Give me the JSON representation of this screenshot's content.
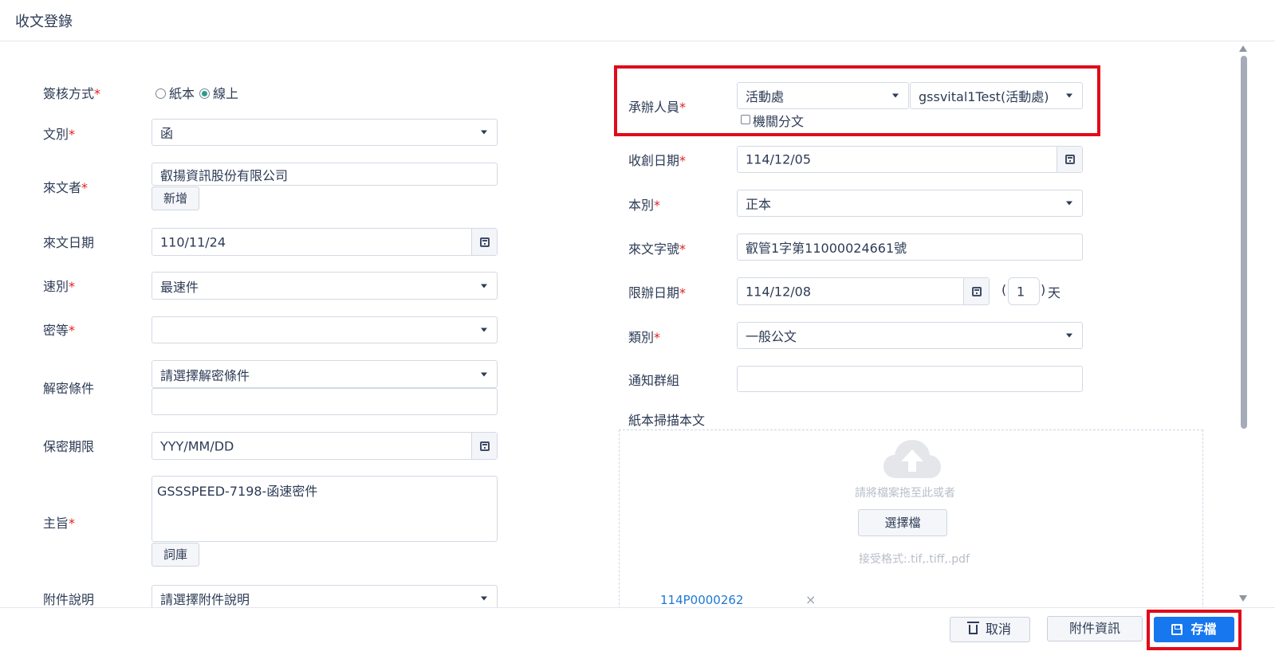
{
  "header": {
    "title": "收文登錄"
  },
  "left": {
    "sign_method": {
      "label": "簽核方式",
      "options": [
        "紙本",
        "線上"
      ],
      "selected": "線上"
    },
    "doc_type": {
      "label": "文別",
      "value": "函"
    },
    "sender": {
      "label": "來文者",
      "value": "叡揚資訊股份有限公司",
      "add_button": "新增"
    },
    "incoming_date": {
      "label": "來文日期",
      "value": "110/11/24"
    },
    "speed": {
      "label": "速別",
      "value": "最速件"
    },
    "secrecy": {
      "label": "密等",
      "value": ""
    },
    "declassify": {
      "label": "解密條件",
      "value": "請選擇解密條件",
      "text": ""
    },
    "retention": {
      "label": "保密期限",
      "placeholder": "YYY/MM/DD"
    },
    "subject": {
      "label": "主旨",
      "value": "GSSSPEED-7198-函速密件",
      "lexicon_button": "詞庫"
    },
    "attachment_note": {
      "label": "附件說明",
      "value": "請選擇附件說明"
    }
  },
  "right": {
    "handler": {
      "label": "承辦人員",
      "unit": "活動處",
      "person": "gssvital1Test(活動處)",
      "checkbox_label": "機關分文"
    },
    "received_date": {
      "label": "收創日期",
      "value": "114/12/05"
    },
    "copy_type": {
      "label": "本別",
      "value": "正本"
    },
    "doc_number": {
      "label": "來文字號",
      "value": "叡管1字第11000024661號"
    },
    "deadline": {
      "label": "限辦日期",
      "value": "114/12/08",
      "open_paren": "(",
      "days": "1",
      "close_paren": ")",
      "unit": "天"
    },
    "category": {
      "label": "類別",
      "value": "一般公文"
    },
    "notify_group": {
      "label": "通知群組",
      "value": ""
    },
    "scan": {
      "label": "紙本掃描本文",
      "drop_text": "請將檔案拖至此或者",
      "choose_button": "選擇檔",
      "formats": "接受格式:.tif,.tiff,.pdf",
      "file_name": "114P0000262",
      "remove": "×"
    }
  },
  "footer": {
    "cancel": "取消",
    "attachments": "附件資訊",
    "save": "存檔"
  },
  "required_mark": "*",
  "colors": {
    "primary": "#1677ee",
    "highlight": "#e00b1a",
    "text": "#2d3b55",
    "link": "#1e78d6"
  },
  "icons": [
    "calendar-icon",
    "chevron-down-icon",
    "cloud-upload-icon",
    "trash-icon",
    "save-icon",
    "close-icon"
  ]
}
